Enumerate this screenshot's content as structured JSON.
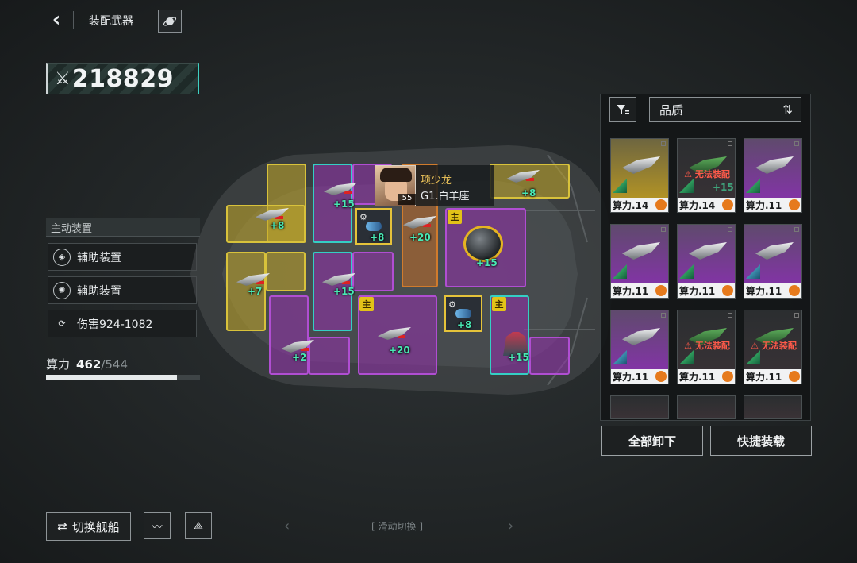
{
  "header": {
    "title": "装配武器"
  },
  "power": {
    "value": "218829"
  },
  "left_panel": {
    "section_title": "主动装置",
    "rows": [
      {
        "label": "辅助装置",
        "icon": "shield-emblem-icon"
      },
      {
        "label": "辅助装置",
        "icon": "target-emblem-icon"
      },
      {
        "label": "伤害924-1082",
        "icon": "damage-icon"
      }
    ],
    "calc_label": "算力",
    "calc_current": "462",
    "calc_max": "/544",
    "calc_fraction": 0.849
  },
  "pilot": {
    "name": "项少龙",
    "rank": "G1.白羊座",
    "level": "55"
  },
  "grid": {
    "bonuses": [
      "+15",
      "+8",
      "+8",
      "+20",
      "+15",
      "+8",
      "+7",
      "+15",
      "+8",
      "+2",
      "+20",
      "+15"
    ],
    "main_tag": "主"
  },
  "inventory": {
    "sort_label": "品质",
    "cards": [
      {
        "label": "算力.14",
        "rarity": "gold",
        "warn": ""
      },
      {
        "label": "算力.14",
        "rarity": "dark",
        "warn": "无法装配",
        "bonus": "+15"
      },
      {
        "label": "算力.11",
        "rarity": "purple",
        "warn": ""
      },
      {
        "label": "算力.11",
        "rarity": "purple",
        "warn": ""
      },
      {
        "label": "算力.11",
        "rarity": "purple",
        "warn": ""
      },
      {
        "label": "算力.11",
        "rarity": "purple",
        "warn": ""
      },
      {
        "label": "算力.11",
        "rarity": "purple",
        "warn": ""
      },
      {
        "label": "算力.11",
        "rarity": "dark",
        "warn": "无法装配"
      },
      {
        "label": "算力.11",
        "rarity": "dark",
        "warn": "无法装配"
      }
    ],
    "unequip_all": "全部卸下",
    "quick_equip": "快捷装载"
  },
  "bottom": {
    "switch_ship": "切换舰船",
    "swipe_hint": "滑动切换"
  },
  "colors": {
    "accent": "#3fd1c3",
    "gold": "#d8c23b",
    "purple": "#b04ed2",
    "green_bonus": "#49e8b4"
  }
}
